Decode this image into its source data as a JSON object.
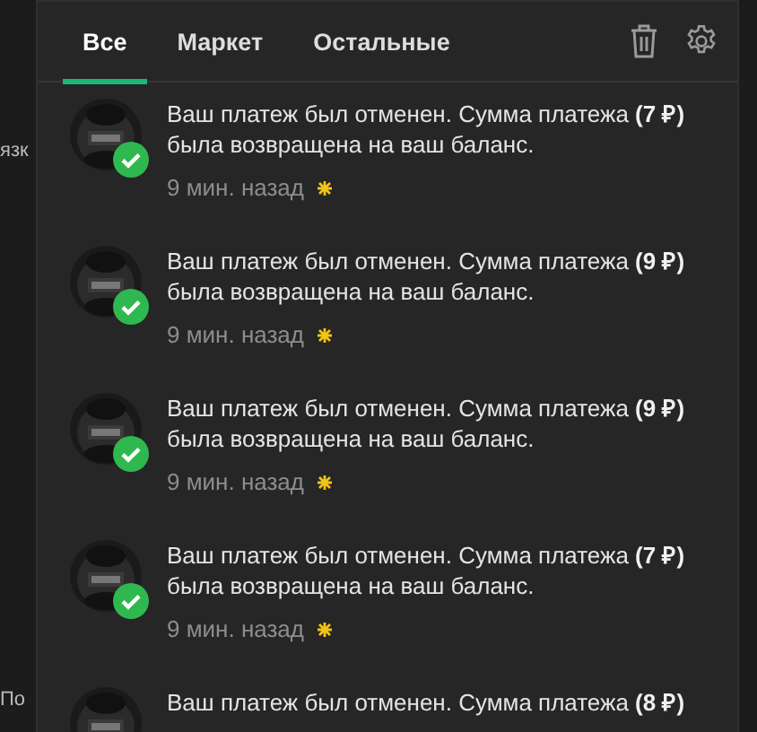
{
  "background": {
    "texts": [
      "язк",
      "По"
    ]
  },
  "tabs": [
    {
      "label": "Все",
      "selected": true
    },
    {
      "label": "Маркет",
      "selected": false
    },
    {
      "label": "Остальные",
      "selected": false
    }
  ],
  "notifications": [
    {
      "text": "Ваш платеж был отменен. Сумма платежа **(7 ₽)** была возвращена на ваш баланс.",
      "time": "9 мин. назад",
      "unread": true
    },
    {
      "text": "Ваш платеж был отменен. Сумма платежа **(9 ₽)** была возвращена на ваш баланс.",
      "time": "9 мин. назад",
      "unread": true
    },
    {
      "text": "Ваш платеж был отменен. Сумма платежа **(9 ₽)** была возвращена на ваш баланс.",
      "time": "9 мин. назад",
      "unread": true
    },
    {
      "text": "Ваш платеж был отменен. Сумма платежа **(7 ₽)** была возвращена на ваш баланс.",
      "time": "9 мин. назад",
      "unread": true
    },
    {
      "text": "Ваш платеж был отменен. Сумма платежа **(8 ₽)**"
    }
  ]
}
